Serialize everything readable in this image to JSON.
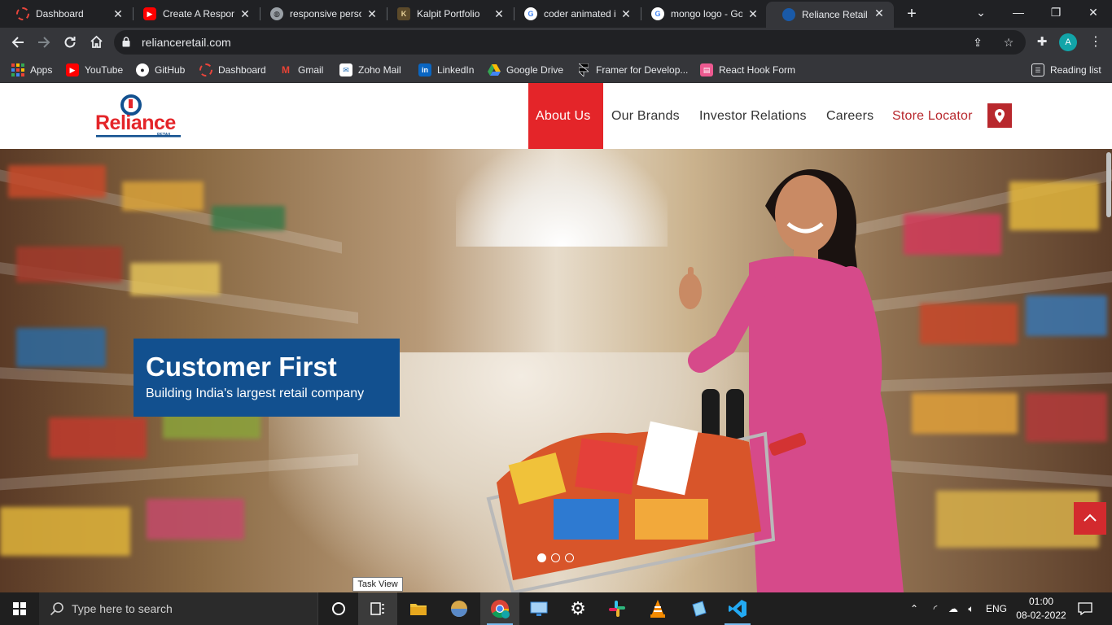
{
  "browser": {
    "tabs": [
      {
        "title": "Dashboard",
        "favicon": "dashboard-ring-icon",
        "color": "#e8453c"
      },
      {
        "title": "Create A Responsive",
        "favicon": "youtube-icon",
        "color": "#ff0000"
      },
      {
        "title": "responsive personal",
        "favicon": "globe-icon",
        "color": "#9aa0a6"
      },
      {
        "title": "Kalpit Portfolio",
        "favicon": "portfolio-icon",
        "color": "#5c4a2a"
      },
      {
        "title": "coder animated im",
        "favicon": "google-icon",
        "color": "#ffffff"
      },
      {
        "title": "mongo logo - Goog",
        "favicon": "google-icon",
        "color": "#ffffff"
      },
      {
        "title": "Reliance Retail",
        "favicon": "reliance-icon",
        "color": "#1a5aa8",
        "active": true
      }
    ],
    "address": {
      "url": "relianceretail.com"
    },
    "profile_initial": "A",
    "bookmarks": [
      {
        "label": "Apps",
        "icon": "apps-grid-icon"
      },
      {
        "label": "YouTube",
        "icon": "youtube-icon"
      },
      {
        "label": "GitHub",
        "icon": "github-icon"
      },
      {
        "label": "Dashboard",
        "icon": "dashboard-ring-icon"
      },
      {
        "label": "Gmail",
        "icon": "gmail-icon"
      },
      {
        "label": "Zoho Mail",
        "icon": "zoho-mail-icon"
      },
      {
        "label": "LinkedIn",
        "icon": "linkedin-icon"
      },
      {
        "label": "Google Drive",
        "icon": "google-drive-icon"
      },
      {
        "label": "Framer for Develop...",
        "icon": "framer-icon"
      },
      {
        "label": "React Hook Form",
        "icon": "react-hook-form-icon"
      }
    ],
    "reading_list": "Reading list"
  },
  "site": {
    "brand": {
      "name": "Reliance",
      "sub": "RETAIL",
      "red": "#e42529",
      "blue": "#12508f"
    },
    "nav": [
      {
        "label": "About Us",
        "active": true
      },
      {
        "label": "Our Brands"
      },
      {
        "label": "Investor Relations"
      },
      {
        "label": "Careers"
      },
      {
        "label": "Store Locator"
      }
    ],
    "hero": {
      "heading": "Customer First",
      "subheading": "Building India's largest retail company",
      "slides": 3,
      "active_slide": 1
    }
  },
  "tooltip": "Task View",
  "taskbar": {
    "search_placeholder": "Type here to search",
    "language": "ENG",
    "time": "01:00",
    "date": "08-02-2022"
  }
}
